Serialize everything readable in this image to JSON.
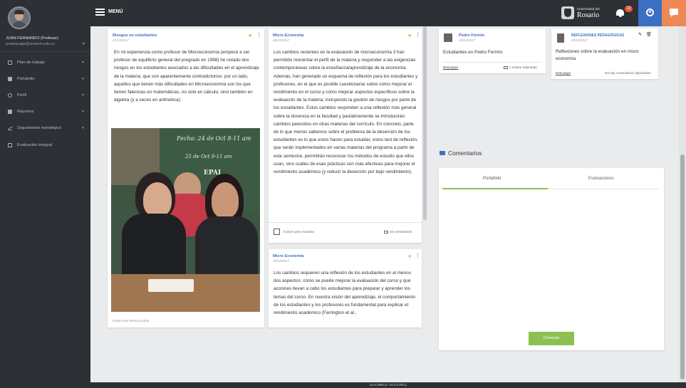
{
  "user": {
    "name": "JUAN FERNANDO (Profesor)",
    "email": "pruebauapp@urosario.edu.co"
  },
  "sidebar": {
    "items": [
      {
        "label": "Plan de trabajo",
        "icon": "plan-icon",
        "has_caret": true
      },
      {
        "label": "Portafolio",
        "icon": "folder-icon",
        "has_caret": true
      },
      {
        "label": "Perfil",
        "icon": "user-icon",
        "has_caret": true
      },
      {
        "label": "Reportes",
        "icon": "report-icon",
        "has_caret": true
      },
      {
        "label": "Seguimiento estratégico",
        "icon": "trend-icon",
        "has_caret": true
      },
      {
        "label": "Evaluación integral",
        "icon": "evaluation-icon",
        "has_caret": false
      }
    ]
  },
  "header": {
    "menu_label": "MENÚ",
    "logo_line1": "Universidad del",
    "logo_line2": "Rosario",
    "notification_count": "12"
  },
  "cards": {
    "card1": {
      "title": "Riesgos en estudiantes",
      "date": "27/10/2017",
      "text": "En mi experiencia como profesor de Microeconomía (empecé a ser profesor de equilibrio general del pregrado en 1998) he notado dos riesgos en los estudiantes asociados a las dificultades en el aprendizaje de la materia, que son aparentemente contradictorios: por un lado, aquellos que tienen más dificultades en Microeconomía son los que tienen falencias en matemáticas, no solo en cálculo, sino también en álgebra (y a veces en aritmética).",
      "photo_text1": "Fecha: 24 de Oct  8-11 am",
      "photo_text2": "25 de Oct  9-11 am",
      "photo_text3": "EPAI",
      "footer": "Evidencias Relacionadas"
    },
    "card2": {
      "title": "Micro Economía",
      "date": "20/10/2017",
      "text": "Los cambios recientes en la evaluación de microeconomía 3 han permitido reorientar el perfil de la materia y responder a las exigencias contemporáneas sobre la enseñanza/aprendizaje de la economía. Además, han generado un esquema de reflexión para los estudiantes y profesores, en el que es posible cuestionarse sobre cómo mejorar el rendimiento en el curso y cómo mejorar aspectos específicos sobre la evaluación de la materia, incluyendo la gestión de riesgos por parte de los estudiantes. Estos cambios responden a una reflexión más general sobre la docencia en la facultad y paulatinamente se introducirán cambios parecidos en otras materias del currículo. En concreto, parte de lo que menos sabemos sobre el problema de la deserción de los estudiantes es lo que estos hacen para estudiar, estos test de reflexión, que serán implementados en varias materias del programa a partir de este semestre, permitirán reconocer los métodos de estudio que ellos usan, sino cuáles de esas prácticas son más efectivas para mejorar el rendimiento académico (y reducir la deserción por bajo rendimiento).",
      "checkbox_label": "Incluir como muestra",
      "comments": "10 comentarios"
    },
    "card3": {
      "title": "Micro Economía",
      "date": "20/10/2017",
      "text": "Los cambios requieren una reflexión de los estudiantes en al menos dos aspectos: cómo se puede mejorar la evaluación del curso y qué acciones llevan a cabo los estudiantes para preparar y aprender los temas del curso. En nuestra visión del aprendizaje, el comportamiento de los estudiantes y los profesores es fundamental para explicar el rendimiento académico (Farrington et al.,"
    },
    "card4": {
      "title": "Pedro Fermín",
      "date": "20/10/2017",
      "text": "Estudiantes en Pedro Fermín.",
      "link": "Descargar",
      "comments": "1 enlace adjuntado"
    },
    "card5": {
      "title": "REFLEXIONES PEDAGÓGICAS",
      "date": "20/10/2017",
      "text": "Reflexiones sobre la evaluación en micro economía",
      "link": "Descargar",
      "comments": "No hay comentarios adjuntados"
    }
  },
  "comments_panel": {
    "title": "Comentarios",
    "tab1": "Portafolio",
    "tab2": "Evaluaciones",
    "button": "Conectar"
  },
  "footer": {
    "version": "v0.0.29RC2 / v0.0.27RC1"
  },
  "colors": {
    "accent": "#3b6fc4",
    "green": "#8cc152",
    "orange": "#ee8855",
    "dark": "#2d3035"
  }
}
